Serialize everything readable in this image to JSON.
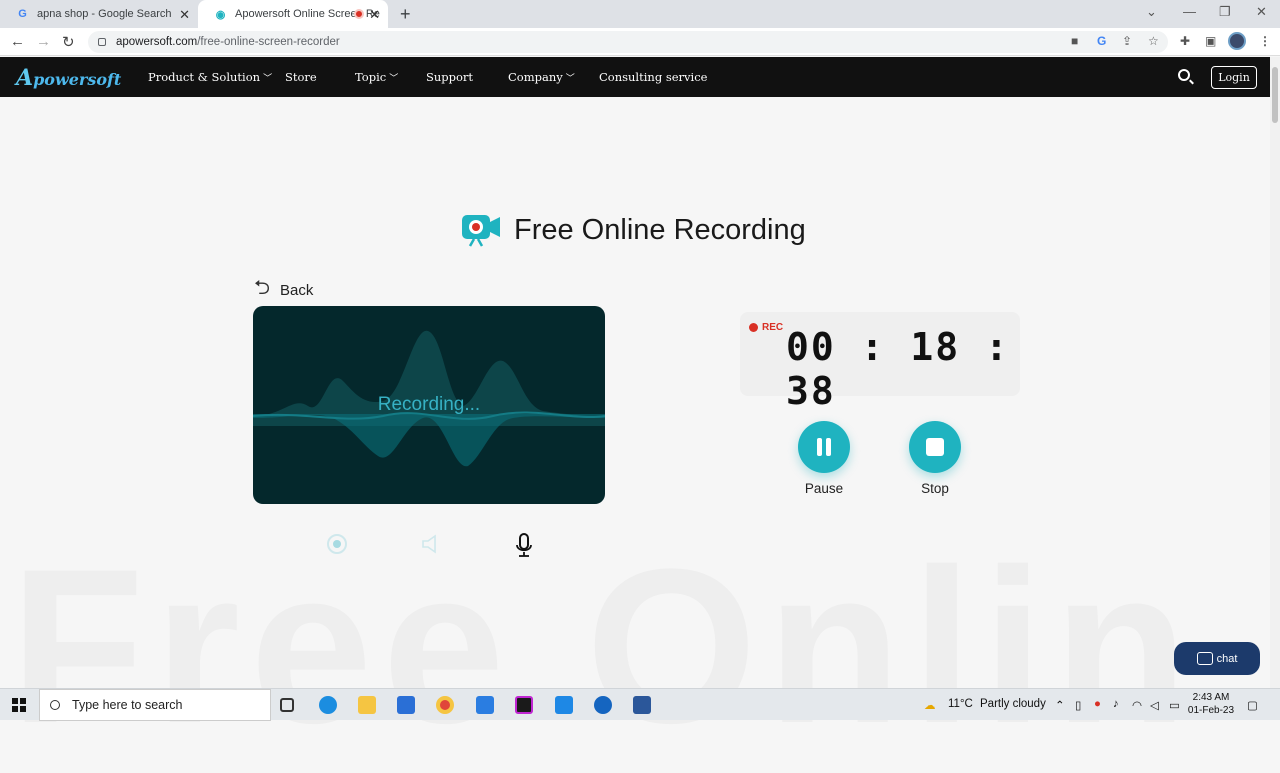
{
  "browser": {
    "tabs": [
      {
        "title": "apna shop - Google Search",
        "favicon": "google-icon"
      },
      {
        "title": "Apowersoft Online Screen Re",
        "favicon": "apowersoft-icon",
        "recording": true
      }
    ],
    "url_domain": "apowersoft.com",
    "url_path": "/free-online-screen-recorder"
  },
  "site_nav": {
    "logo": "powersoft",
    "logo_initial": "A",
    "items": [
      {
        "label": "Product & Solution",
        "dropdown": true
      },
      {
        "label": "Store",
        "dropdown": false
      },
      {
        "label": "Topic",
        "dropdown": true
      },
      {
        "label": "Support",
        "dropdown": false
      },
      {
        "label": "Company",
        "dropdown": true
      },
      {
        "label": "Consulting service",
        "dropdown": false
      }
    ],
    "login_label": "Login"
  },
  "main": {
    "title": "Free Online Recording",
    "back_label": "Back",
    "recording_status": "Recording...",
    "rec_badge": "REC",
    "timer": "00 : 18 : 38",
    "pause_label": "Pause",
    "stop_label": "Stop",
    "background_text": "Free Onlin",
    "sources": [
      "webcam-icon",
      "speaker-icon",
      "microphone-icon"
    ]
  },
  "chat_label": "chat",
  "taskbar": {
    "search_placeholder": "Type here to search",
    "weather_temp": "11°C",
    "weather_text": "Partly cloudy",
    "time": "2:43 AM",
    "date": "01-Feb-23"
  },
  "colors": {
    "accent": "#1fb3c0",
    "panel_bg": "#04282c",
    "nav_bg": "#111111",
    "rec_red": "#d93025"
  }
}
